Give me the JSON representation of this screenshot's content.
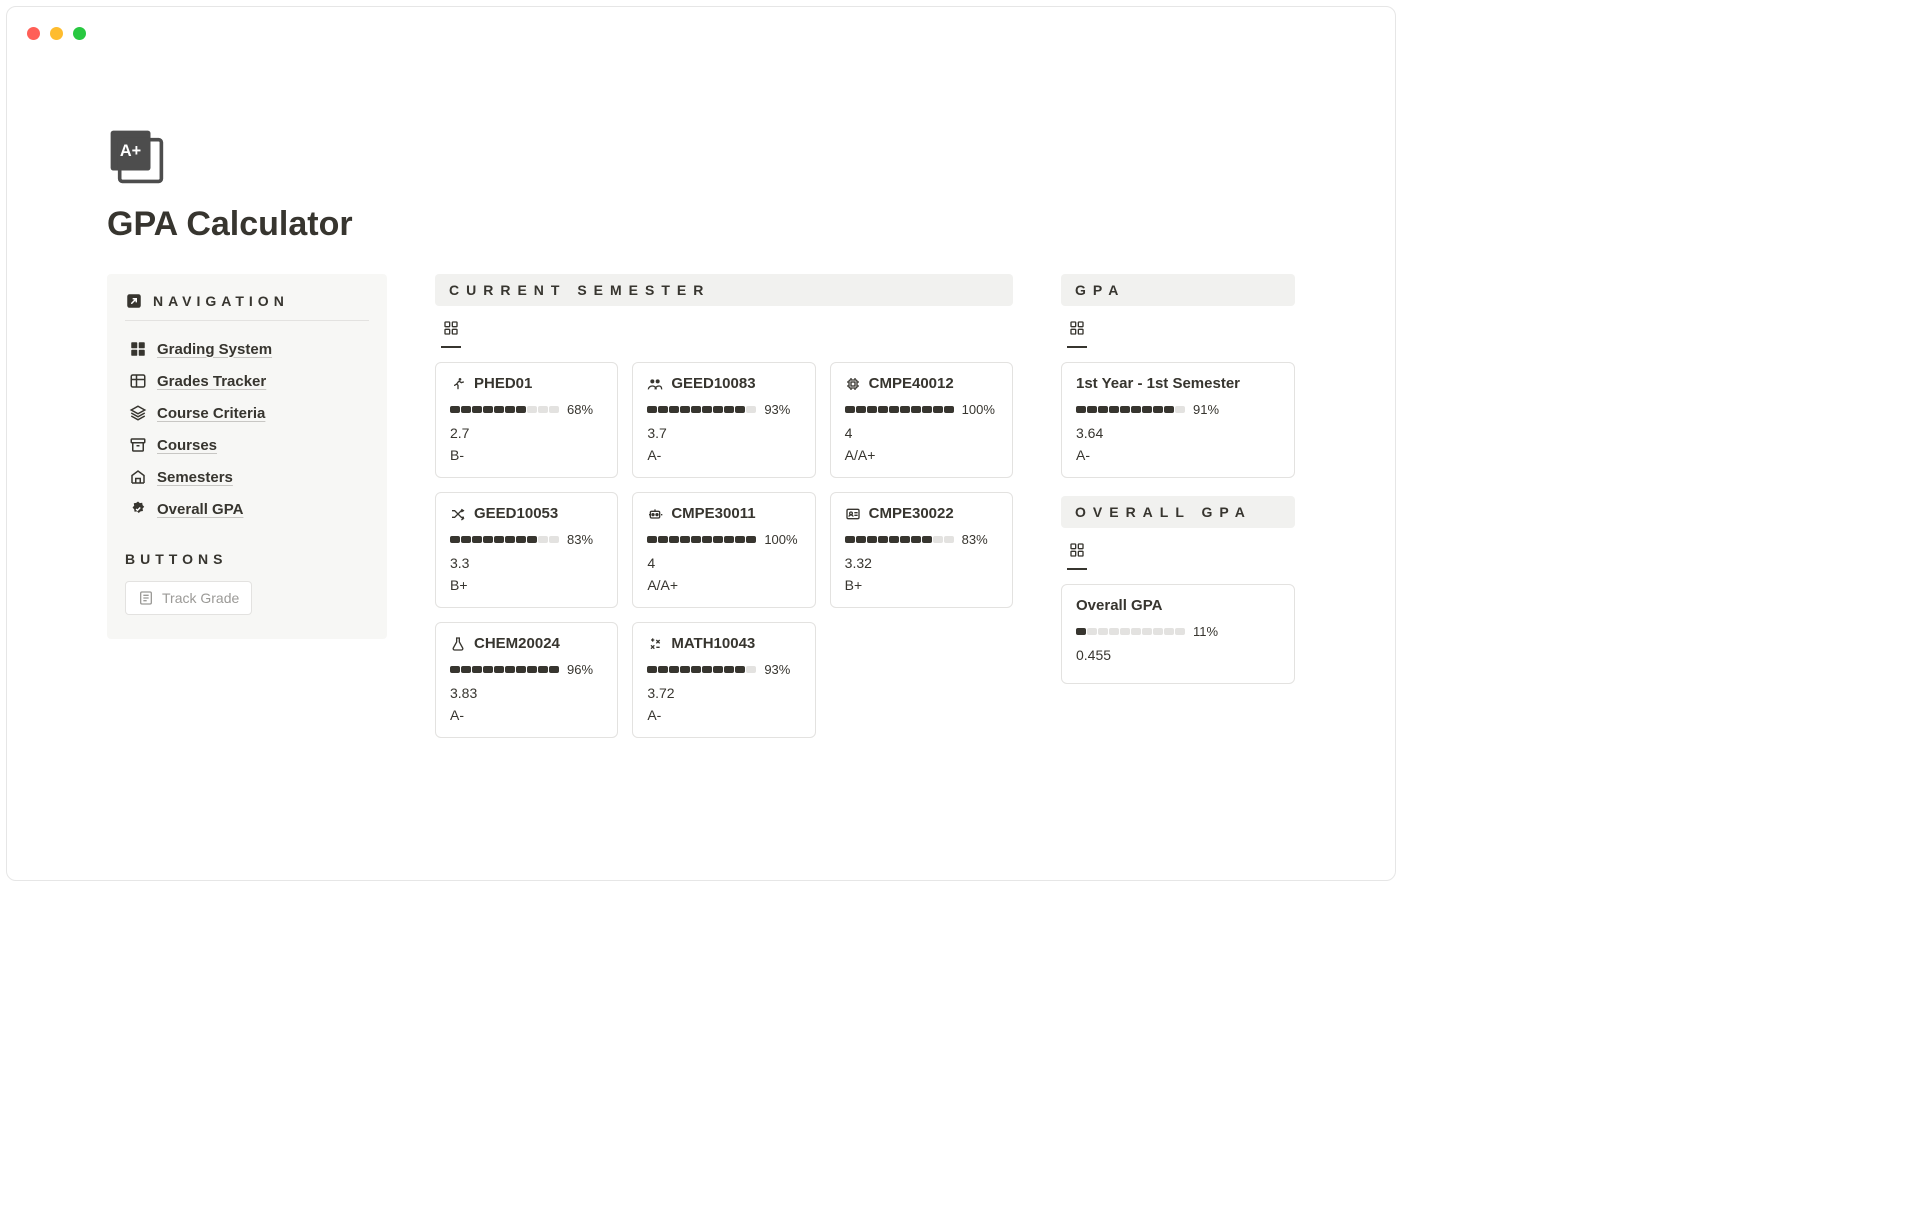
{
  "page": {
    "title": "GPA Calculator"
  },
  "sidebar": {
    "nav_heading": "NAVIGATION",
    "buttons_heading": "BUTTONS",
    "items": [
      {
        "label": "Grading System",
        "icon": "grid-icon"
      },
      {
        "label": "Grades Tracker",
        "icon": "table-icon"
      },
      {
        "label": "Course Criteria",
        "icon": "layers-icon"
      },
      {
        "label": "Courses",
        "icon": "archive-icon"
      },
      {
        "label": "Semesters",
        "icon": "school-icon"
      },
      {
        "label": "Overall GPA",
        "icon": "badge-icon"
      }
    ],
    "track_button": "Track Grade"
  },
  "current_semester": {
    "heading": "CURRENT SEMESTER",
    "cards": [
      {
        "icon": "running-icon",
        "code": "PHED01",
        "pct": "68%",
        "fill": 7,
        "gpa": "2.7",
        "grade": "B-"
      },
      {
        "icon": "people-icon",
        "code": "GEED10083",
        "pct": "93%",
        "fill": 9,
        "gpa": "3.7",
        "grade": "A-"
      },
      {
        "icon": "chip-icon",
        "code": "CMPE40012",
        "pct": "100%",
        "fill": 10,
        "gpa": "4",
        "grade": "A/A+"
      },
      {
        "icon": "shuffle-icon",
        "code": "GEED10053",
        "pct": "83%",
        "fill": 8,
        "gpa": "3.3",
        "grade": "B+"
      },
      {
        "icon": "robot-icon",
        "code": "CMPE30011",
        "pct": "100%",
        "fill": 10,
        "gpa": "4",
        "grade": "A/A+"
      },
      {
        "icon": "id-icon",
        "code": "CMPE30022",
        "pct": "83%",
        "fill": 8,
        "gpa": "3.32",
        "grade": "B+"
      },
      {
        "icon": "flask-icon",
        "code": "CHEM20024",
        "pct": "96%",
        "fill": 10,
        "gpa": "3.83",
        "grade": "A-"
      },
      {
        "icon": "calc-icon",
        "code": "MATH10043",
        "pct": "93%",
        "fill": 9,
        "gpa": "3.72",
        "grade": "A-"
      }
    ]
  },
  "gpa": {
    "heading": "GPA",
    "card": {
      "title": "1st Year - 1st Semester",
      "pct": "91%",
      "fill": 9,
      "value": "3.64",
      "grade": "A-"
    }
  },
  "overall": {
    "heading": "OVERALL GPA",
    "card": {
      "title": "Overall GPA",
      "pct": "11%",
      "fill": 1,
      "value": "0.455"
    }
  }
}
